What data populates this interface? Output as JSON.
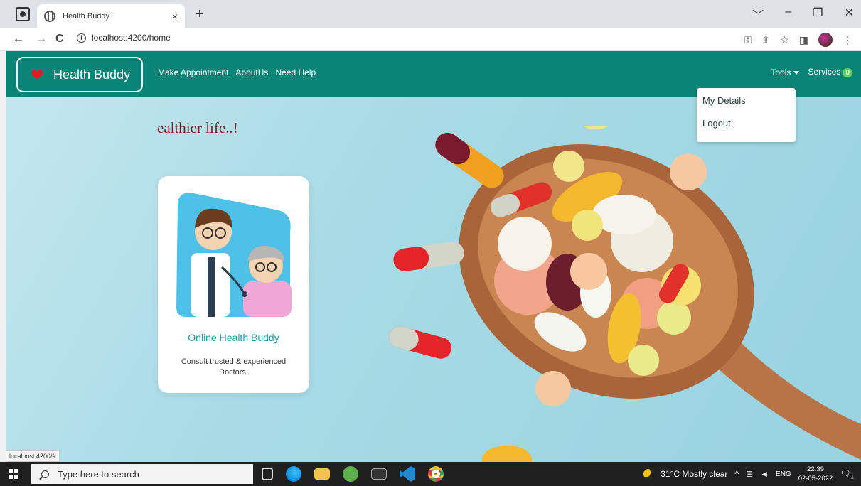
{
  "browser": {
    "tab_title": "Health Buddy",
    "tab_close": "×",
    "new_tab": "+",
    "window_controls": [
      "﹀",
      "–",
      "❐",
      "✕"
    ],
    "url": "localhost:4200/home",
    "nav": {
      "back": "←",
      "forward": "→",
      "reload": "C"
    },
    "right_icons": [
      "key-icon",
      "share-icon",
      "star-icon",
      "sidepanel-icon",
      "profile-avatar",
      "menu-icon"
    ],
    "status_url": "localhost:4200/#"
  },
  "app": {
    "brand": "Health Buddy",
    "nav_links": [
      "Make Appointment",
      "AboutUs",
      "Need Help"
    ],
    "tools_label": "Tools",
    "services_label": "Services",
    "services_badge": "0",
    "dropdown_items": [
      "My Details",
      "Logout"
    ],
    "tagline": "ealthier life..!",
    "card": {
      "title": "Online Health Buddy",
      "text": "Consult trusted & experienced Doctors."
    },
    "colors": {
      "navbar": "#0b8478",
      "accent": "#1aa3a3",
      "tagline": "#7a1e1e"
    }
  },
  "taskbar": {
    "search_placeholder": "Type here to search",
    "apps": [
      "task-view-icon",
      "edge-icon",
      "file-explorer-icon",
      "spring-tool-icon",
      "terminal-icon",
      "vscode-icon",
      "chrome-icon"
    ],
    "weather": "31°C  Mostly clear",
    "language": "ENG",
    "time": "22:39",
    "date": "02-05-2022",
    "notification_count": "1"
  }
}
